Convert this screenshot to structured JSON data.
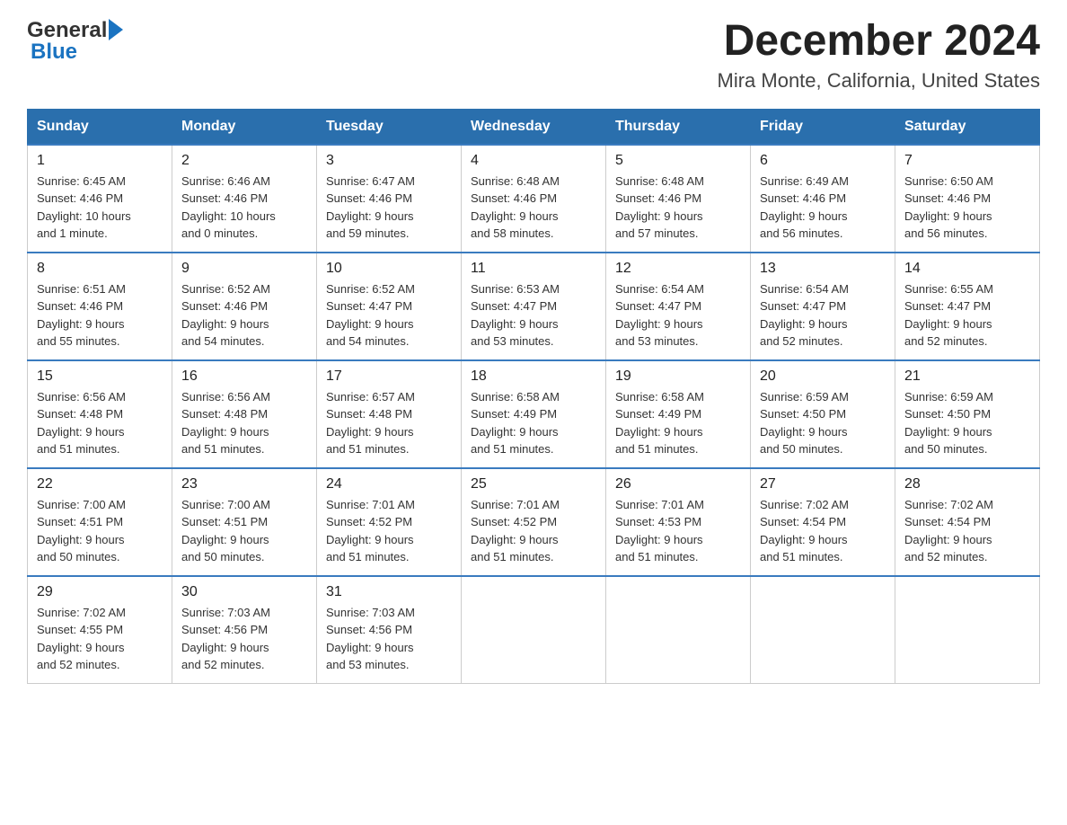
{
  "logo": {
    "general": "General",
    "blue": "Blue"
  },
  "title": "December 2024",
  "subtitle": "Mira Monte, California, United States",
  "days_of_week": [
    "Sunday",
    "Monday",
    "Tuesday",
    "Wednesday",
    "Thursday",
    "Friday",
    "Saturday"
  ],
  "weeks": [
    [
      {
        "day": "1",
        "info": "Sunrise: 6:45 AM\nSunset: 4:46 PM\nDaylight: 10 hours\nand 1 minute."
      },
      {
        "day": "2",
        "info": "Sunrise: 6:46 AM\nSunset: 4:46 PM\nDaylight: 10 hours\nand 0 minutes."
      },
      {
        "day": "3",
        "info": "Sunrise: 6:47 AM\nSunset: 4:46 PM\nDaylight: 9 hours\nand 59 minutes."
      },
      {
        "day": "4",
        "info": "Sunrise: 6:48 AM\nSunset: 4:46 PM\nDaylight: 9 hours\nand 58 minutes."
      },
      {
        "day": "5",
        "info": "Sunrise: 6:48 AM\nSunset: 4:46 PM\nDaylight: 9 hours\nand 57 minutes."
      },
      {
        "day": "6",
        "info": "Sunrise: 6:49 AM\nSunset: 4:46 PM\nDaylight: 9 hours\nand 56 minutes."
      },
      {
        "day": "7",
        "info": "Sunrise: 6:50 AM\nSunset: 4:46 PM\nDaylight: 9 hours\nand 56 minutes."
      }
    ],
    [
      {
        "day": "8",
        "info": "Sunrise: 6:51 AM\nSunset: 4:46 PM\nDaylight: 9 hours\nand 55 minutes."
      },
      {
        "day": "9",
        "info": "Sunrise: 6:52 AM\nSunset: 4:46 PM\nDaylight: 9 hours\nand 54 minutes."
      },
      {
        "day": "10",
        "info": "Sunrise: 6:52 AM\nSunset: 4:47 PM\nDaylight: 9 hours\nand 54 minutes."
      },
      {
        "day": "11",
        "info": "Sunrise: 6:53 AM\nSunset: 4:47 PM\nDaylight: 9 hours\nand 53 minutes."
      },
      {
        "day": "12",
        "info": "Sunrise: 6:54 AM\nSunset: 4:47 PM\nDaylight: 9 hours\nand 53 minutes."
      },
      {
        "day": "13",
        "info": "Sunrise: 6:54 AM\nSunset: 4:47 PM\nDaylight: 9 hours\nand 52 minutes."
      },
      {
        "day": "14",
        "info": "Sunrise: 6:55 AM\nSunset: 4:47 PM\nDaylight: 9 hours\nand 52 minutes."
      }
    ],
    [
      {
        "day": "15",
        "info": "Sunrise: 6:56 AM\nSunset: 4:48 PM\nDaylight: 9 hours\nand 51 minutes."
      },
      {
        "day": "16",
        "info": "Sunrise: 6:56 AM\nSunset: 4:48 PM\nDaylight: 9 hours\nand 51 minutes."
      },
      {
        "day": "17",
        "info": "Sunrise: 6:57 AM\nSunset: 4:48 PM\nDaylight: 9 hours\nand 51 minutes."
      },
      {
        "day": "18",
        "info": "Sunrise: 6:58 AM\nSunset: 4:49 PM\nDaylight: 9 hours\nand 51 minutes."
      },
      {
        "day": "19",
        "info": "Sunrise: 6:58 AM\nSunset: 4:49 PM\nDaylight: 9 hours\nand 51 minutes."
      },
      {
        "day": "20",
        "info": "Sunrise: 6:59 AM\nSunset: 4:50 PM\nDaylight: 9 hours\nand 50 minutes."
      },
      {
        "day": "21",
        "info": "Sunrise: 6:59 AM\nSunset: 4:50 PM\nDaylight: 9 hours\nand 50 minutes."
      }
    ],
    [
      {
        "day": "22",
        "info": "Sunrise: 7:00 AM\nSunset: 4:51 PM\nDaylight: 9 hours\nand 50 minutes."
      },
      {
        "day": "23",
        "info": "Sunrise: 7:00 AM\nSunset: 4:51 PM\nDaylight: 9 hours\nand 50 minutes."
      },
      {
        "day": "24",
        "info": "Sunrise: 7:01 AM\nSunset: 4:52 PM\nDaylight: 9 hours\nand 51 minutes."
      },
      {
        "day": "25",
        "info": "Sunrise: 7:01 AM\nSunset: 4:52 PM\nDaylight: 9 hours\nand 51 minutes."
      },
      {
        "day": "26",
        "info": "Sunrise: 7:01 AM\nSunset: 4:53 PM\nDaylight: 9 hours\nand 51 minutes."
      },
      {
        "day": "27",
        "info": "Sunrise: 7:02 AM\nSunset: 4:54 PM\nDaylight: 9 hours\nand 51 minutes."
      },
      {
        "day": "28",
        "info": "Sunrise: 7:02 AM\nSunset: 4:54 PM\nDaylight: 9 hours\nand 52 minutes."
      }
    ],
    [
      {
        "day": "29",
        "info": "Sunrise: 7:02 AM\nSunset: 4:55 PM\nDaylight: 9 hours\nand 52 minutes."
      },
      {
        "day": "30",
        "info": "Sunrise: 7:03 AM\nSunset: 4:56 PM\nDaylight: 9 hours\nand 52 minutes."
      },
      {
        "day": "31",
        "info": "Sunrise: 7:03 AM\nSunset: 4:56 PM\nDaylight: 9 hours\nand 53 minutes."
      },
      null,
      null,
      null,
      null
    ]
  ]
}
